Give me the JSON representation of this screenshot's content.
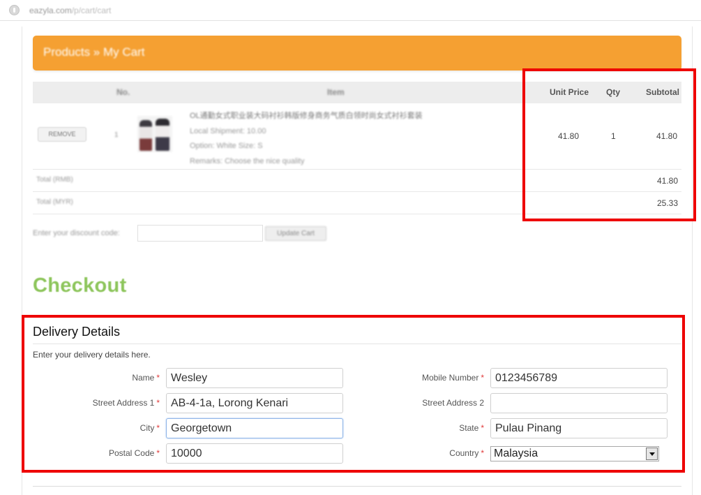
{
  "browser": {
    "url_host": "eazyla.com",
    "url_path": "/p/cart/cart"
  },
  "banner": {
    "title": "Products » My Cart"
  },
  "cart": {
    "headers": {
      "no": "No.",
      "item": "Item",
      "unit_price": "Unit Price",
      "qty": "Qty",
      "subtotal": "Subtotal"
    },
    "rows": [
      {
        "remove_label": "REMOVE",
        "no": "1",
        "title": "OL通勤女式职业装大码衬衫韩版修身商务气质白领时尚女式衬衫套装",
        "shipment": "Local Shipment: 10.00",
        "option": "Option: White    Size: S",
        "remarks": "Remarks: Choose the nice quality",
        "unit_price": "41.80",
        "qty": "1",
        "subtotal": "41.80"
      }
    ],
    "totals": [
      {
        "label": "Total (RMB)",
        "value": "41.80"
      },
      {
        "label": "Total (MYR)",
        "value": "25.33"
      }
    ],
    "discount": {
      "label": "Enter your discount code:",
      "value": "",
      "button": "Update Cart"
    }
  },
  "checkout": {
    "title": "Checkout"
  },
  "delivery": {
    "title": "Delivery Details",
    "description": "Enter your delivery details here.",
    "required_mark": "*",
    "fields": {
      "name": {
        "label": "Name",
        "value": "Wesley"
      },
      "mobile": {
        "label": "Mobile Number",
        "value": "0123456789"
      },
      "street1": {
        "label": "Street Address 1",
        "value": "AB-4-1a, Lorong Kenari"
      },
      "street2": {
        "label": "Street Address 2",
        "value": ""
      },
      "city": {
        "label": "City",
        "value": "Georgetown"
      },
      "state": {
        "label": "State",
        "value": "Pulau Pinang"
      },
      "postal": {
        "label": "Postal Code",
        "value": "10000"
      },
      "country": {
        "label": "Country",
        "value": "Malaysia"
      }
    }
  },
  "colors": {
    "banner": "#f5a032",
    "checkout_title": "#8dc55b",
    "annotation": "#ee0000",
    "required": "#e03b3b"
  },
  "icons": {
    "browser_page": "globe-icon",
    "select_arrow": "chevron-down-icon"
  }
}
